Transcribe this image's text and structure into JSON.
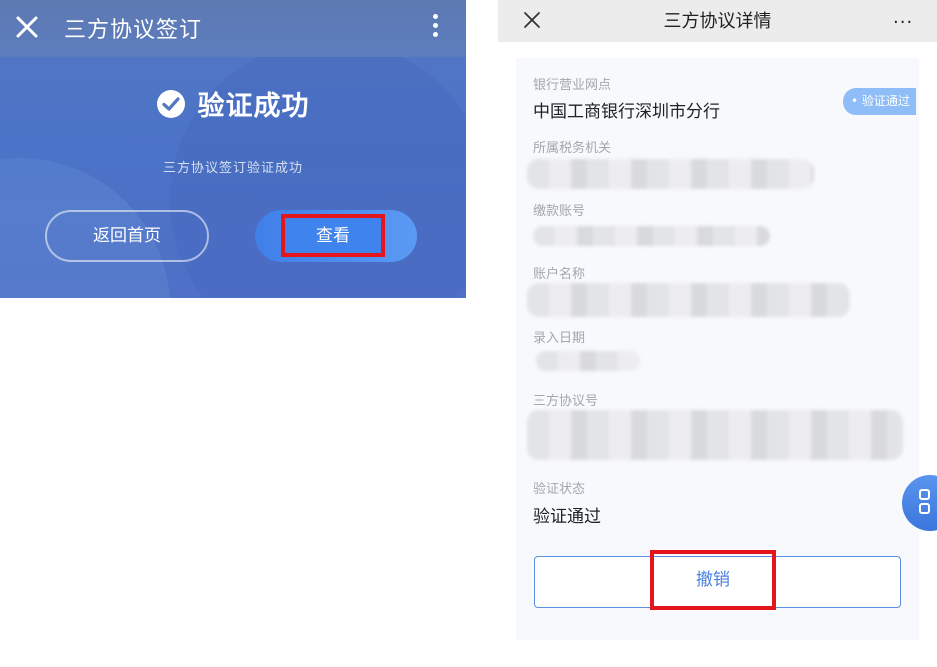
{
  "left_screen": {
    "title": "三方协议签订",
    "success_text": "验证成功",
    "success_subtext": "三方协议签订验证成功",
    "home_button": "返回首页",
    "view_button": "查看"
  },
  "right_screen": {
    "title": "三方协议详情",
    "more": "···",
    "badge": "• 验证通过",
    "fields": [
      {
        "label": "银行营业网点",
        "value": "中国工商银行深圳市分行"
      },
      {
        "label": "所属税务机关",
        "value": ""
      },
      {
        "label": "缴款账号",
        "value": ""
      },
      {
        "label": "账户名称",
        "value": ""
      },
      {
        "label": "录入日期",
        "value": ""
      },
      {
        "label": "三方协议号",
        "value": ""
      },
      {
        "label": "验证状态",
        "value": "验证通过"
      }
    ],
    "revoke_button": "撤销"
  },
  "colors": {
    "header_blue": "#5c7cbd",
    "primary_blue": "#4a7fdb",
    "highlight_red": "#e4161b",
    "badge_blue": "#8ebdf7"
  },
  "icons": [
    "close-icon",
    "more-vertical-icon",
    "check-circle-icon",
    "more-horizontal-icon",
    "grid-menu-icon"
  ]
}
